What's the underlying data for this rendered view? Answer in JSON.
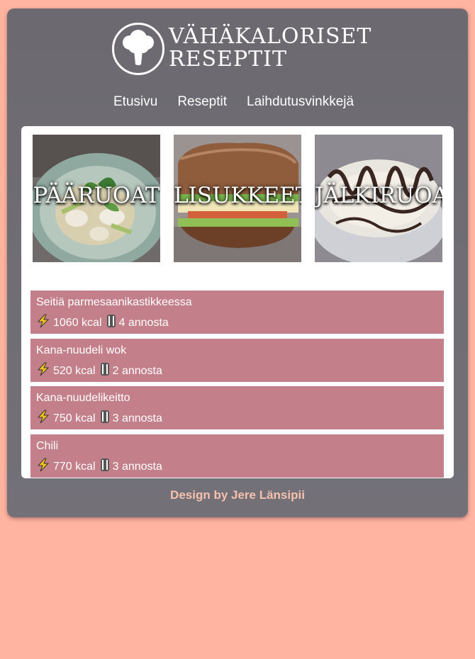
{
  "header": {
    "logo_line1": "VÄHÄKALORISET",
    "logo_line2": "RESEPTIT",
    "logo_icon": "broccoli-icon"
  },
  "nav": {
    "items": [
      "Etusivu",
      "Reseptit",
      "Laihdutusvinkkejä"
    ]
  },
  "categories": [
    {
      "label": "PÄÄRUOAT",
      "image": "pasta-dish"
    },
    {
      "label": "LISUKKEET",
      "image": "sandwich"
    },
    {
      "label": "JÄLKIRUOAT",
      "image": "dessert"
    }
  ],
  "recipes": [
    {
      "title": "Seitiä parmesaanikastikkeessa",
      "kcal": "1060 kcal",
      "servings": "4 annosta"
    },
    {
      "title": "Kana-nuudeli wok",
      "kcal": "520 kcal",
      "servings": "2 annosta"
    },
    {
      "title": "Kana-nuudelikeitto",
      "kcal": "750 kcal",
      "servings": "3 annosta"
    },
    {
      "title": "Chili",
      "kcal": "770 kcal",
      "servings": "3 annosta"
    }
  ],
  "icons": {
    "energy": "lightning-icon",
    "servings": "cutlery-icon"
  },
  "colors": {
    "background": "#ffb3a1",
    "card": "#6f6c74",
    "recipe_row": "#c4808a",
    "footer_text": "#f6c2ad"
  },
  "footer": {
    "text": "Design by Jere Länsipii"
  }
}
